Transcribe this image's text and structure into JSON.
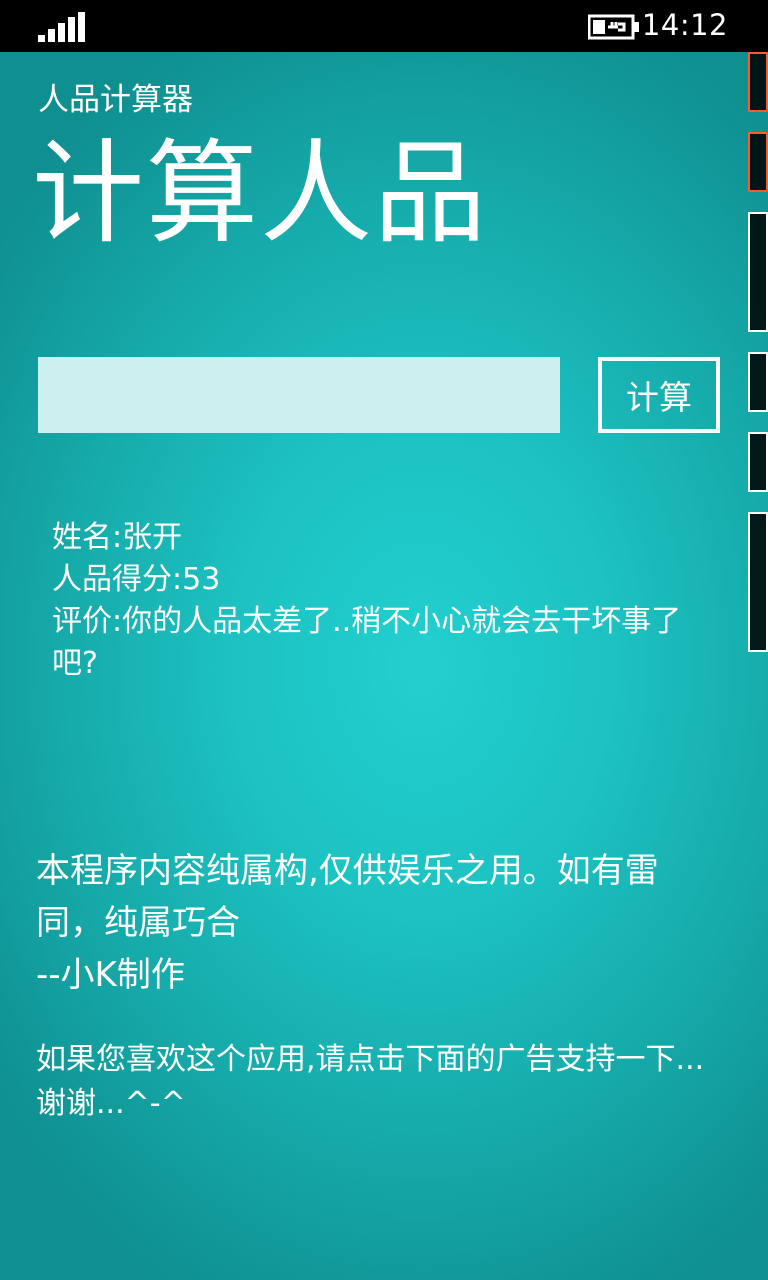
{
  "status_bar": {
    "time": "14:12",
    "signal_icon": "signal-bars-icon",
    "battery_icon": "battery-charging-icon"
  },
  "app": {
    "title": "人品计算器",
    "page_title": "计算人品"
  },
  "form": {
    "name_value": "",
    "calculate_label": "计算"
  },
  "result": {
    "name_line": "姓名:张开",
    "score_line": "人品得分:53",
    "comment_line": "评价:你的人品太差了..稍不小心就会去干坏事了吧?"
  },
  "disclaimer": {
    "line1": "本程序内容纯属构,仅供娱乐之用。如有雷同，纯属巧合",
    "line2": "--小K制作"
  },
  "support_text": "如果您喜欢这个应用,请点击下面的广告支持一下...谢谢...^-^",
  "colors": {
    "background": "#1dc2c2",
    "input_fill": "#cbf0ef",
    "text": "#ffffff",
    "counter_red": "#ff5a28"
  }
}
